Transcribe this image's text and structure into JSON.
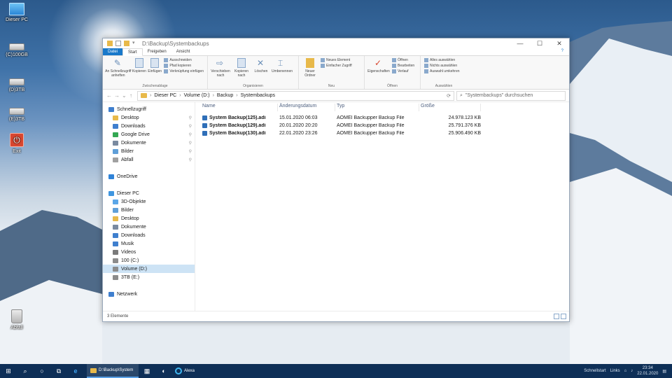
{
  "desktop": {
    "icons": [
      {
        "label": "Dieser PC",
        "icon": "computer-icon"
      },
      {
        "label": "(C)100GB",
        "icon": "drive-icon"
      },
      {
        "label": "(D)3TB",
        "icon": "drive-icon"
      },
      {
        "label": "(E)3TB",
        "icon": "drive-icon"
      },
      {
        "label": "Exit",
        "icon": "exit-icon"
      },
      {
        "label": "Abfall",
        "icon": "recycle-bin-icon"
      }
    ]
  },
  "window": {
    "title": "D:\\Backup\\Systembackups",
    "controls": {
      "minimize": "—",
      "maximize": "☐",
      "close": "✕"
    },
    "tabs": {
      "file": "Datei",
      "start": "Start",
      "share": "Freigeben",
      "view": "Ansicht"
    },
    "help": "?",
    "ribbon": {
      "clipboard": {
        "pin": "An Schnellzugriff anheften",
        "copy": "Kopieren",
        "paste": "Einfügen",
        "cut": "Ausschneiden",
        "copy_path": "Pfad kopieren",
        "paste_shortcut": "Verknüpfung einfügen",
        "label": "Zwischenablage"
      },
      "organize": {
        "move_to": "Verschieben nach",
        "copy_to": "Kopieren nach",
        "delete": "Löschen",
        "rename": "Umbenennen",
        "label": "Organisieren"
      },
      "new": {
        "new_folder": "Neuer Ordner",
        "new_item": "Neues Element",
        "easy_access": "Einfacher Zugriff",
        "label": "Neu"
      },
      "open": {
        "properties": "Eigenschaften",
        "open": "Öffnen",
        "edit": "Bearbeiten",
        "history": "Verlauf",
        "label": "Öffnen"
      },
      "select": {
        "select_all": "Alles auswählen",
        "select_none": "Nichts auswählen",
        "invert": "Auswahl umkehren",
        "label": "Auswählen"
      }
    },
    "nav": {
      "back": "←",
      "forward": "→",
      "recent": "⌄",
      "up": "↑",
      "breadcrumb": [
        "Dieser PC",
        "Volume (D:)",
        "Backup",
        "Systembackups"
      ],
      "refresh": "⟳",
      "search_placeholder": "\"Systembackups\" durchsuchen"
    },
    "sidebar": [
      {
        "label": "Schnellzugriff",
        "icon": "star-icon",
        "pinned": false,
        "level": 0
      },
      {
        "label": "Desktop",
        "icon": "folder-icon",
        "pinned": true,
        "level": 1
      },
      {
        "label": "Downloads",
        "icon": "download-icon",
        "pinned": true,
        "level": 1
      },
      {
        "label": "Google Drive",
        "icon": "google-drive-icon",
        "pinned": true,
        "level": 1
      },
      {
        "label": "Dokumente",
        "icon": "document-icon",
        "pinned": true,
        "level": 1
      },
      {
        "label": "Bilder",
        "icon": "picture-icon",
        "pinned": true,
        "level": 1
      },
      {
        "label": "Abfall",
        "icon": "recycle-bin-icon",
        "pinned": true,
        "level": 1
      },
      {
        "label": "",
        "icon": "",
        "pinned": false,
        "level": -1
      },
      {
        "label": "OneDrive",
        "icon": "cloud-icon",
        "pinned": false,
        "level": 0
      },
      {
        "label": "",
        "icon": "",
        "pinned": false,
        "level": -1
      },
      {
        "label": "Dieser PC",
        "icon": "computer-icon",
        "pinned": false,
        "level": 0
      },
      {
        "label": "3D-Objekte",
        "icon": "cube-icon",
        "pinned": false,
        "level": 1
      },
      {
        "label": "Bilder",
        "icon": "picture-icon",
        "pinned": false,
        "level": 1
      },
      {
        "label": "Desktop",
        "icon": "folder-icon",
        "pinned": false,
        "level": 1
      },
      {
        "label": "Dokumente",
        "icon": "document-icon",
        "pinned": false,
        "level": 1
      },
      {
        "label": "Downloads",
        "icon": "download-icon",
        "pinned": false,
        "level": 1
      },
      {
        "label": "Musik",
        "icon": "music-icon",
        "pinned": false,
        "level": 1
      },
      {
        "label": "Videos",
        "icon": "video-icon",
        "pinned": false,
        "level": 1
      },
      {
        "label": "100 (C:)",
        "icon": "drive-icon",
        "pinned": false,
        "level": 1
      },
      {
        "label": "Volume (D:)",
        "icon": "drive-icon",
        "pinned": false,
        "level": 1,
        "selected": true
      },
      {
        "label": "3TB (E:)",
        "icon": "drive-icon",
        "pinned": false,
        "level": 1
      },
      {
        "label": "",
        "icon": "",
        "pinned": false,
        "level": -1
      },
      {
        "label": "Netzwerk",
        "icon": "network-icon",
        "pinned": false,
        "level": 0
      }
    ],
    "columns": {
      "name": "Name",
      "date": "Änderungsdatum",
      "type": "Typ",
      "size": "Größe"
    },
    "files": [
      {
        "name": "System Backup(125).adi",
        "date": "15.01.2020 06:03",
        "type": "AOMEI Backupper Backup File",
        "size": "24.978.123 KB"
      },
      {
        "name": "System Backup(129).adi",
        "date": "20.01.2020 20:20",
        "type": "AOMEI Backupper Backup File",
        "size": "25.791.376 KB"
      },
      {
        "name": "System Backup(130).adi",
        "date": "22.01.2020 23:26",
        "type": "AOMEI Backupper Backup File",
        "size": "25.906.490 KB"
      }
    ],
    "status": "3 Elemente"
  },
  "taskbar": {
    "start": "⊞",
    "search": "⌕",
    "cortana": "○",
    "taskview": "⧉",
    "app_label": "D:\\Backup\\System",
    "alexa": "Alexa",
    "quick_access": "Schnellstart",
    "links": "Links",
    "time": "23:34",
    "date": "22.01.2020"
  }
}
